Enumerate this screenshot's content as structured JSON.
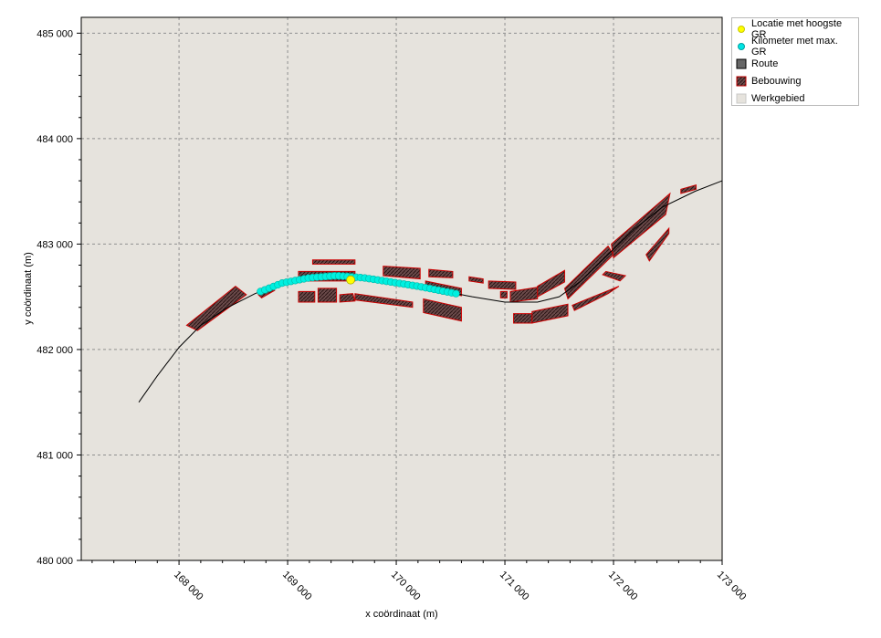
{
  "chart_data": {
    "type": "map",
    "xlabel": "x coördinaat (m)",
    "ylabel": "y coördinaat (m)",
    "xlim": [
      167100,
      173000
    ],
    "ylim": [
      480000,
      485150
    ],
    "x_ticks": [
      {
        "value": 168000,
        "label": "168 000"
      },
      {
        "value": 169000,
        "label": "169 000"
      },
      {
        "value": 170000,
        "label": "170 000"
      },
      {
        "value": 171000,
        "label": "171 000"
      },
      {
        "value": 172000,
        "label": "172 000"
      },
      {
        "value": 173000,
        "label": "173 000"
      }
    ],
    "y_ticks": [
      {
        "value": 480000,
        "label": "480 000"
      },
      {
        "value": 481000,
        "label": "481 000"
      },
      {
        "value": 482000,
        "label": "482 000"
      },
      {
        "value": 483000,
        "label": "483 000"
      },
      {
        "value": 484000,
        "label": "484 000"
      },
      {
        "value": 485000,
        "label": "485 000"
      }
    ],
    "grid": true,
    "legend_position": "outside-top-right",
    "background_color": "#e6e3dd",
    "legend": [
      {
        "label": "Locatie met hoogste GR",
        "symbol": "circle",
        "color": "#ffff00"
      },
      {
        "label": "Kilometer met max. GR",
        "symbol": "circle",
        "color": "#00e5e5"
      },
      {
        "label": "Route",
        "symbol": "square",
        "color": "#666666"
      },
      {
        "label": "Bebouwing",
        "symbol": "hatched-square",
        "color": "#c00000"
      },
      {
        "label": "Werkgebied",
        "symbol": "square",
        "color": "#e6e3dd"
      }
    ],
    "route": [
      [
        167630,
        481500
      ],
      [
        167800,
        481750
      ],
      [
        168000,
        482020
      ],
      [
        168200,
        482230
      ],
      [
        168450,
        482400
      ],
      [
        168700,
        482530
      ],
      [
        168950,
        482630
      ],
      [
        169200,
        482680
      ],
      [
        169450,
        482700
      ],
      [
        169700,
        482680
      ],
      [
        169950,
        482640
      ],
      [
        170200,
        482600
      ],
      [
        170450,
        482550
      ],
      [
        170700,
        482500
      ],
      [
        171000,
        482450
      ],
      [
        171300,
        482450
      ],
      [
        171500,
        482500
      ],
      [
        171700,
        482650
      ],
      [
        171950,
        482900
      ],
      [
        172200,
        483150
      ],
      [
        172450,
        483350
      ],
      [
        172750,
        483500
      ],
      [
        173000,
        483600
      ]
    ],
    "max_gr_kilometer": {
      "x_start": 168750,
      "x_end": 170550
    },
    "highest_gr_location": [
      169580,
      482660
    ],
    "buildings": [
      [
        [
          168070,
          482230
        ],
        [
          168520,
          482600
        ],
        [
          168620,
          482520
        ],
        [
          168170,
          482180
        ]
      ],
      [
        [
          168730,
          482520
        ],
        [
          168850,
          482600
        ],
        [
          168880,
          482560
        ],
        [
          168760,
          482490
        ]
      ],
      [
        [
          169100,
          482740
        ],
        [
          169620,
          482740
        ],
        [
          169620,
          482650
        ],
        [
          169100,
          482650
        ]
      ],
      [
        [
          169230,
          482850
        ],
        [
          169620,
          482850
        ],
        [
          169620,
          482810
        ],
        [
          169230,
          482810
        ]
      ],
      [
        [
          169100,
          482550
        ],
        [
          169250,
          482550
        ],
        [
          169250,
          482450
        ],
        [
          169100,
          482450
        ]
      ],
      [
        [
          169280,
          482580
        ],
        [
          169450,
          482580
        ],
        [
          169450,
          482450
        ],
        [
          169280,
          482450
        ]
      ],
      [
        [
          169480,
          482520
        ],
        [
          169600,
          482530
        ],
        [
          169620,
          482460
        ],
        [
          169480,
          482450
        ]
      ],
      [
        [
          169620,
          482530
        ],
        [
          170150,
          482450
        ],
        [
          170150,
          482400
        ],
        [
          169620,
          482470
        ]
      ],
      [
        [
          169880,
          482790
        ],
        [
          170220,
          482770
        ],
        [
          170220,
          482670
        ],
        [
          169880,
          482700
        ]
      ],
      [
        [
          170300,
          482760
        ],
        [
          170520,
          482740
        ],
        [
          170520,
          482680
        ],
        [
          170300,
          482690
        ]
      ],
      [
        [
          170270,
          482650
        ],
        [
          170600,
          482580
        ],
        [
          170600,
          482510
        ],
        [
          170270,
          482580
        ]
      ],
      [
        [
          170250,
          482480
        ],
        [
          170600,
          482400
        ],
        [
          170600,
          482270
        ],
        [
          170250,
          482350
        ]
      ],
      [
        [
          170670,
          482690
        ],
        [
          170800,
          482670
        ],
        [
          170800,
          482630
        ],
        [
          170670,
          482650
        ]
      ],
      [
        [
          170850,
          482650
        ],
        [
          171100,
          482640
        ],
        [
          171100,
          482570
        ],
        [
          170850,
          482580
        ]
      ],
      [
        [
          170960,
          482550
        ],
        [
          171020,
          482550
        ],
        [
          171020,
          482490
        ],
        [
          170960,
          482490
        ]
      ],
      [
        [
          171050,
          482550
        ],
        [
          171300,
          482590
        ],
        [
          171300,
          482480
        ],
        [
          171050,
          482450
        ]
      ],
      [
        [
          171300,
          482600
        ],
        [
          171550,
          482750
        ],
        [
          171550,
          482640
        ],
        [
          171300,
          482500
        ]
      ],
      [
        [
          171080,
          482340
        ],
        [
          171250,
          482340
        ],
        [
          171250,
          482250
        ],
        [
          171080,
          482250
        ]
      ],
      [
        [
          171250,
          482360
        ],
        [
          171580,
          482430
        ],
        [
          171580,
          482320
        ],
        [
          171250,
          482250
        ]
      ],
      [
        [
          171550,
          482580
        ],
        [
          171950,
          482980
        ],
        [
          172000,
          482900
        ],
        [
          171580,
          482480
        ]
      ],
      [
        [
          171620,
          482420
        ],
        [
          172050,
          482600
        ],
        [
          171950,
          482530
        ],
        [
          171640,
          482370
        ]
      ],
      [
        [
          171930,
          482740
        ],
        [
          172110,
          482700
        ],
        [
          172060,
          482650
        ],
        [
          171900,
          482710
        ]
      ],
      [
        [
          171980,
          483000
        ],
        [
          172520,
          483480
        ],
        [
          172480,
          483280
        ],
        [
          172000,
          482870
        ]
      ],
      [
        [
          172300,
          482900
        ],
        [
          172510,
          483150
        ],
        [
          172510,
          483100
        ],
        [
          172330,
          482840
        ]
      ],
      [
        [
          172620,
          483520
        ],
        [
          172760,
          483560
        ],
        [
          172760,
          483520
        ],
        [
          172620,
          483480
        ]
      ]
    ]
  }
}
